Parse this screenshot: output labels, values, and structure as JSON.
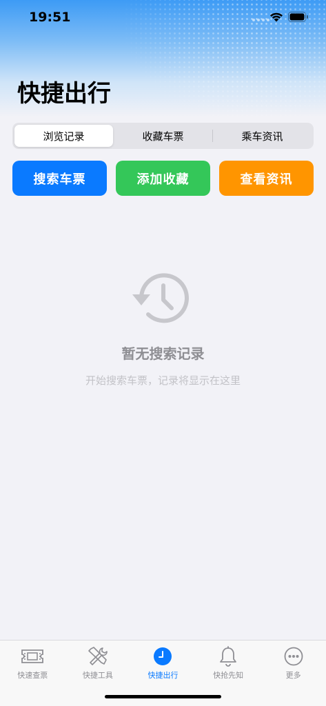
{
  "status_bar": {
    "time": "19:51"
  },
  "header": {
    "title": "快捷出行"
  },
  "segments": [
    {
      "label": "浏览记录",
      "active": true
    },
    {
      "label": "收藏车票",
      "active": false
    },
    {
      "label": "乘车资讯",
      "active": false
    }
  ],
  "actions": [
    {
      "label": "搜索车票",
      "color": "#0a7aff"
    },
    {
      "label": "添加收藏",
      "color": "#34c759"
    },
    {
      "label": "查看资讯",
      "color": "#ff9500"
    }
  ],
  "empty_state": {
    "icon": "history-clock-icon",
    "title": "暂无搜索记录",
    "subtitle": "开始搜索车票，记录将显示在这里"
  },
  "tabbar": [
    {
      "label": "快速查票",
      "icon": "ticket-icon",
      "active": false
    },
    {
      "label": "快捷工具",
      "icon": "tools-icon",
      "active": false
    },
    {
      "label": "快捷出行",
      "icon": "clock-icon",
      "active": true
    },
    {
      "label": "快抢先知",
      "icon": "bell-icon",
      "active": false
    },
    {
      "label": "更多",
      "icon": "more-icon",
      "active": false
    }
  ],
  "colors": {
    "accent": "#0a7aff",
    "inactive": "#8e8e93"
  }
}
